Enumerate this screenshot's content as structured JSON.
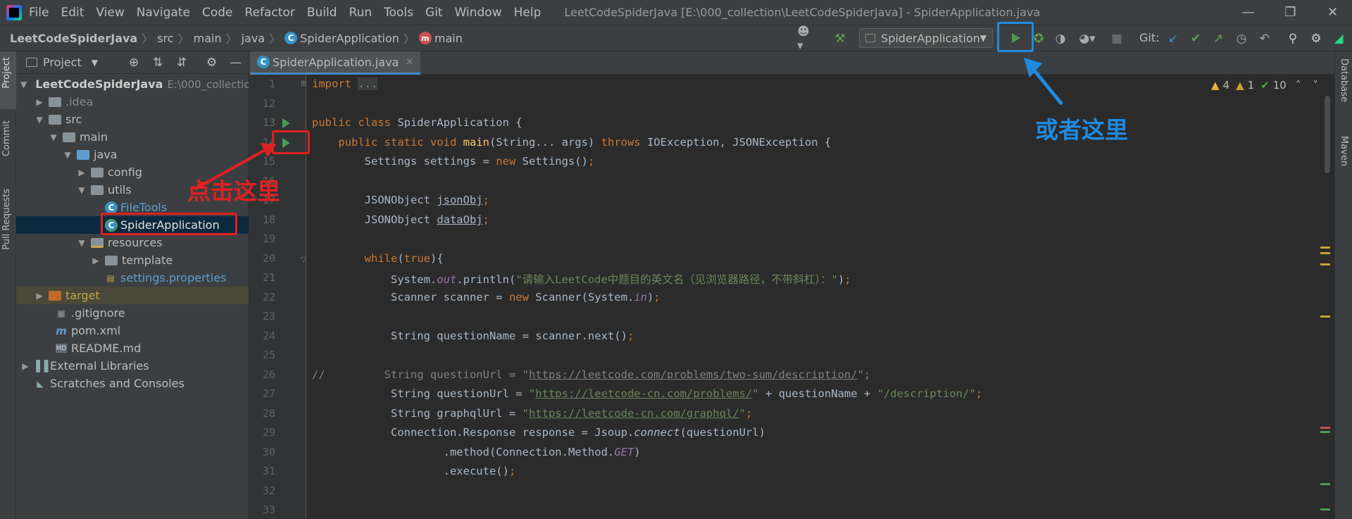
{
  "menubar": {
    "items": [
      "File",
      "Edit",
      "View",
      "Navigate",
      "Code",
      "Refactor",
      "Build",
      "Run",
      "Tools",
      "Git",
      "Window",
      "Help"
    ],
    "window_title": "LeetCodeSpiderJava [E:\\000_collection\\LeetCodeSpiderJava] - SpiderApplication.java"
  },
  "navbar": {
    "crumbs": [
      "LeetCodeSpiderJava",
      "src",
      "main",
      "java",
      "SpiderApplication",
      "main"
    ],
    "run_config": "SpiderApplication",
    "git_label": "Git:"
  },
  "left_strip": {
    "tabs": [
      "Project",
      "Commit",
      "Pull Requests"
    ]
  },
  "right_strip": {
    "tabs": [
      "Database",
      "Maven"
    ]
  },
  "project": {
    "header": "Project",
    "tree": [
      {
        "label": "LeetCodeSpiderJava",
        "path": "E:\\000_collectio",
        "icon": "folder",
        "expanded": true
      },
      {
        "label": ".idea",
        "icon": "folder"
      },
      {
        "label": "src",
        "icon": "folder",
        "expanded": true
      },
      {
        "label": "main",
        "icon": "folder",
        "expanded": true
      },
      {
        "label": "java",
        "icon": "folder-blue",
        "expanded": true
      },
      {
        "label": "config",
        "icon": "package"
      },
      {
        "label": "utils",
        "icon": "package",
        "expanded": true
      },
      {
        "label": "FileTools",
        "icon": "class"
      },
      {
        "label": "SpiderApplication",
        "icon": "class-main",
        "selected": true
      },
      {
        "label": "resources",
        "icon": "folder-resources",
        "expanded": true
      },
      {
        "label": "template",
        "icon": "folder"
      },
      {
        "label": "settings.properties",
        "icon": "properties"
      },
      {
        "label": "target",
        "icon": "folder-orange"
      },
      {
        "label": ".gitignore",
        "icon": "file"
      },
      {
        "label": "pom.xml",
        "icon": "maven"
      },
      {
        "label": "README.md",
        "icon": "markdown"
      },
      {
        "label": "External Libraries",
        "icon": "libraries"
      },
      {
        "label": "Scratches and Consoles",
        "icon": "scratches"
      }
    ]
  },
  "editor": {
    "tab": "SpiderApplication.java",
    "inspections": {
      "warnings": "4",
      "weak_warnings": "1",
      "typos": "10"
    },
    "line_numbers": [
      "1",
      "12",
      "13",
      "14",
      "15",
      "16",
      "17",
      "18",
      "19",
      "20",
      "21",
      "22",
      "23",
      "24",
      "25",
      "26",
      "27",
      "28",
      "29",
      "30",
      "31",
      "32",
      "33"
    ]
  },
  "annotations": {
    "click_here": "点击这里",
    "or_here": "或者这里"
  },
  "colors": {
    "annotation_red": "#e02020",
    "annotation_blue": "#1e8ae0"
  }
}
